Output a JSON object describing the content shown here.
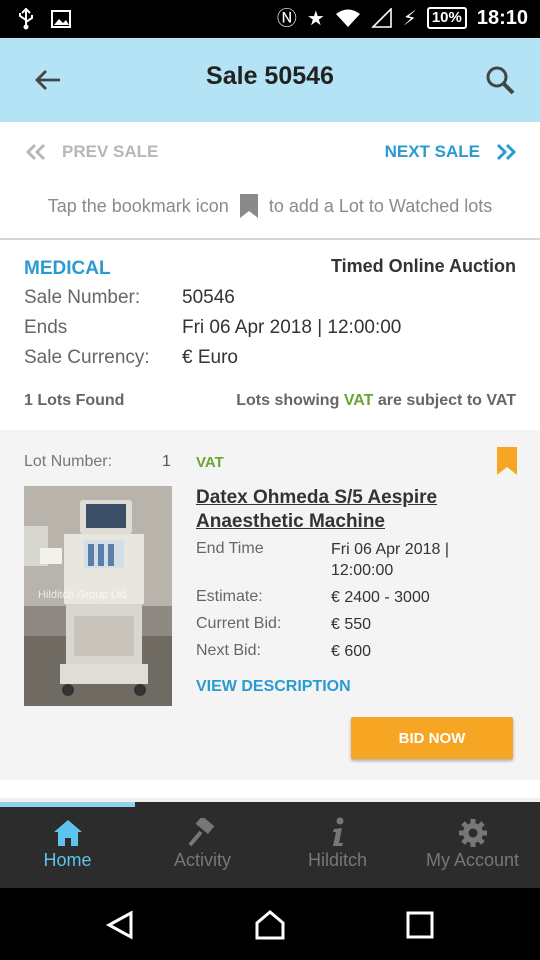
{
  "status_bar": {
    "time": "18:10",
    "battery": "10%",
    "icons": [
      "usb-icon",
      "image-icon",
      "nfc-icon",
      "star-icon",
      "wifi-icon",
      "signal-icon",
      "charging-icon"
    ]
  },
  "header": {
    "title": "Sale 50546",
    "back_icon": "arrow-left-icon",
    "search_icon": "search-icon",
    "background": "#b5e3f6"
  },
  "sale_nav": {
    "prev_label": "PREV SALE",
    "next_label": "NEXT SALE"
  },
  "hint": {
    "before": "Tap the bookmark icon",
    "after": "to add a Lot to Watched lots"
  },
  "sale": {
    "category": "MEDICAL",
    "type": "Timed Online Auction",
    "rows": [
      {
        "label": "Sale Number:",
        "value": "50546"
      },
      {
        "label": "Ends",
        "value": "Fri 06 Apr 2018 | 12:00:00"
      },
      {
        "label": "Sale Currency:",
        "value": "€ Euro"
      }
    ],
    "lots_found": "1 Lots Found",
    "vat_note_pre": "Lots showing",
    "vat_note_word": "VAT",
    "vat_note_post": "are subject to VAT"
  },
  "lot": {
    "number_label": "Lot Number:",
    "number": "1",
    "vat": "VAT",
    "title": "Datex Ohmeda S/5 Aespire Anaesthetic Machine",
    "image_watermark": "Hilditch Group Ltd",
    "details": [
      {
        "label": "End Time",
        "value_line1": "Fri 06 Apr 2018 |",
        "value_line2": "12:00:00"
      },
      {
        "label": "Estimate:",
        "value": "€ 2400 - 3000"
      },
      {
        "label": "Current Bid:",
        "value": "€ 550"
      },
      {
        "label": "Next Bid:",
        "value": "€ 600"
      }
    ],
    "view_description": "VIEW DESCRIPTION",
    "bid_button": "BID NOW"
  },
  "bottom_nav": {
    "items": [
      {
        "label": "Home",
        "icon": "home-icon",
        "active": true
      },
      {
        "label": "Activity",
        "icon": "gavel-icon",
        "active": false
      },
      {
        "label": "Hilditch",
        "icon": "info-icon",
        "active": false
      },
      {
        "label": "My Account",
        "icon": "gear-icon",
        "active": false
      }
    ]
  },
  "colors": {
    "accent_blue": "#2a9bd0",
    "vat_green": "#6aa338",
    "bid_orange": "#f6a623",
    "bookmark_orange": "#f6a623"
  }
}
